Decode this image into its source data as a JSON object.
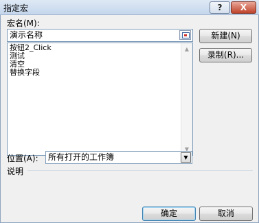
{
  "window": {
    "title": "指定宏",
    "help_label": "?",
    "close_label": "X"
  },
  "form": {
    "name_label": "宏名(M):",
    "name_value": "演示名称",
    "macros": [
      "按钮2_Click",
      "测试",
      "清空",
      "替换字段"
    ],
    "location_label": "位置(A):",
    "location_value": "所有打开的工作簿",
    "description_label": "说明"
  },
  "buttons": {
    "new": "新建(N)",
    "record": "录制(R)...",
    "ok": "确定",
    "cancel": "取消"
  }
}
